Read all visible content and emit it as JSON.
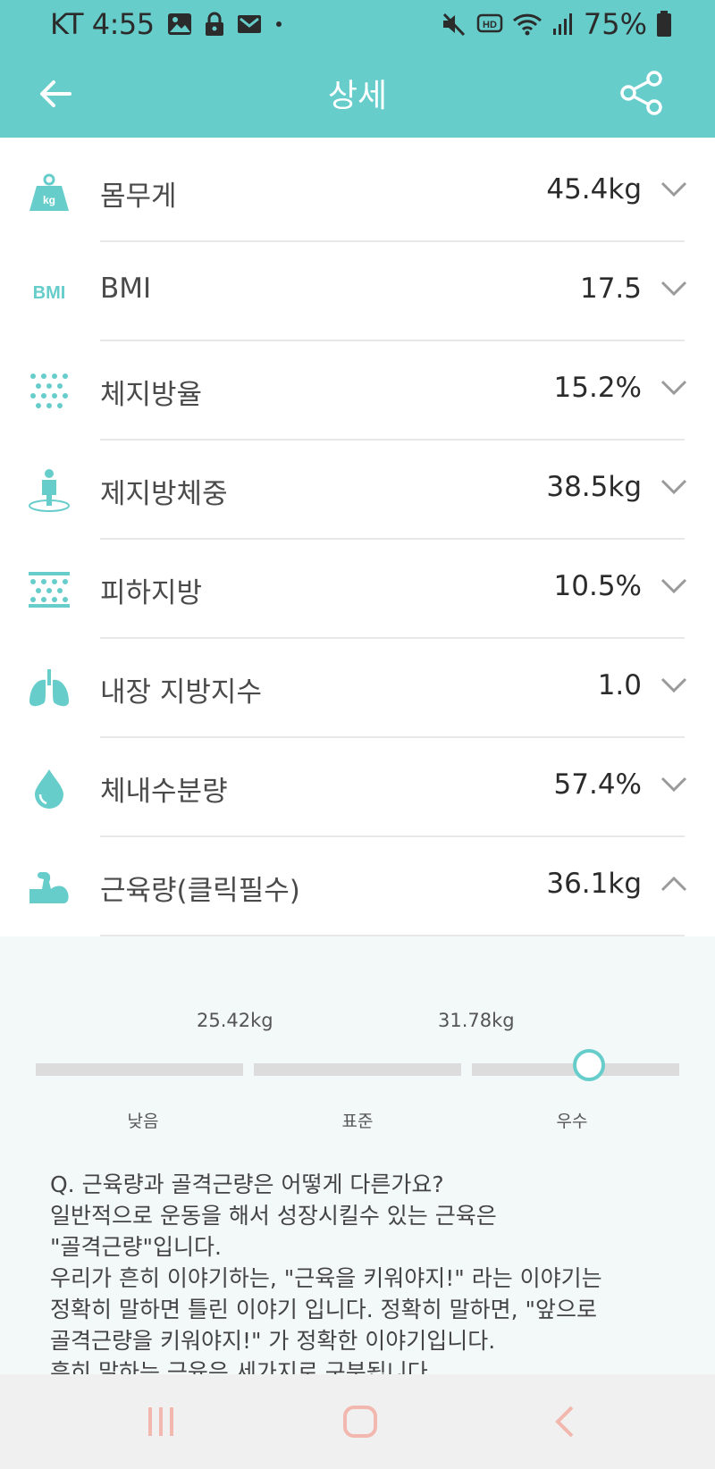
{
  "status_bar": {
    "carrier_time": "KT 4:55",
    "battery_pct": "75%",
    "icons": [
      "image-icon",
      "lock-icon",
      "mail-icon",
      "dot-icon",
      "mute-icon",
      "hd-icon",
      "wifi-icon",
      "signal-icon",
      "battery-icon"
    ]
  },
  "app_bar": {
    "title": "상세",
    "back_icon": "arrow-left-icon",
    "share_icon": "share-icon"
  },
  "metrics": [
    {
      "label": "몸무게",
      "value": "45.4kg",
      "icon": "weight-icon",
      "expanded": false
    },
    {
      "label": "BMI",
      "value": "17.5",
      "icon": "bmi-icon",
      "icon_text": "BMI",
      "expanded": false
    },
    {
      "label": "체지방율",
      "value": "15.2%",
      "icon": "body-fat-icon",
      "expanded": false
    },
    {
      "label": "제지방체중",
      "value": "38.5kg",
      "icon": "lean-mass-icon",
      "expanded": false
    },
    {
      "label": "피하지방",
      "value": "10.5%",
      "icon": "subcutaneous-fat-icon",
      "expanded": false
    },
    {
      "label": "내장 지방지수",
      "value": "1.0",
      "icon": "lungs-icon",
      "expanded": false
    },
    {
      "label": "체내수분량",
      "value": "57.4%",
      "icon": "water-drop-icon",
      "expanded": false
    },
    {
      "label": "근육량(클릭필수)",
      "value": "36.1kg",
      "icon": "muscle-icon",
      "expanded": true
    }
  ],
  "muscle_detail": {
    "thresholds": [
      "25.42kg",
      "31.78kg"
    ],
    "levels": [
      "낮음",
      "표준",
      "우수"
    ],
    "current_level": "우수",
    "marker_position_fraction": 0.86,
    "description_lines": [
      "Q. 근육량과 골격근량은 어떻게 다른가요?",
      "일반적으로 운동을 해서 성장시킬수 있는 근육은",
      "\"골격근량\"입니다.",
      "우리가 흔히 이야기하는, \"근육을 키워야지!\" 라는 이야기는",
      "정확히 말하면 틀린 이야기 입니다. 정확히 말하면, \"앞으로",
      "골격근량을 키워야지!\" 가 정확한 이야기입니다.",
      "흔히 말하는 근육은 세가지로 구분됩니다"
    ]
  },
  "colors": {
    "accent": "#67cdcb",
    "nav_icon": "#f2b8b0"
  },
  "nav_bar": {
    "icons": [
      "recent-apps-icon",
      "home-icon",
      "back-icon"
    ]
  }
}
